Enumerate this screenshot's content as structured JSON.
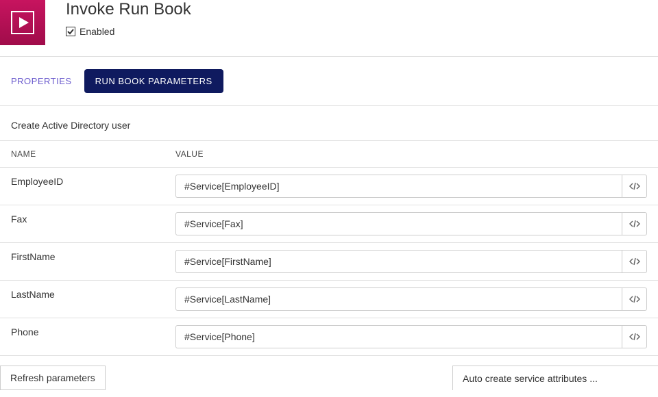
{
  "header": {
    "title": "Invoke Run Book",
    "enabled_label": "Enabled",
    "enabled_checked": true
  },
  "tabs": {
    "properties": "PROPERTIES",
    "parameters": "RUN BOOK PARAMETERS"
  },
  "subtitle": "Create Active Directory user",
  "columns": {
    "name": "NAME",
    "value": "VALUE"
  },
  "params": [
    {
      "name": "EmployeeID",
      "value": "#Service[EmployeeID]"
    },
    {
      "name": "Fax",
      "value": "#Service[Fax]"
    },
    {
      "name": "FirstName",
      "value": "#Service[FirstName]"
    },
    {
      "name": "LastName",
      "value": "#Service[LastName]"
    },
    {
      "name": "Phone",
      "value": "#Service[Phone]"
    }
  ],
  "footer": {
    "refresh": "Refresh parameters",
    "auto_create": "Auto create service attributes ..."
  }
}
